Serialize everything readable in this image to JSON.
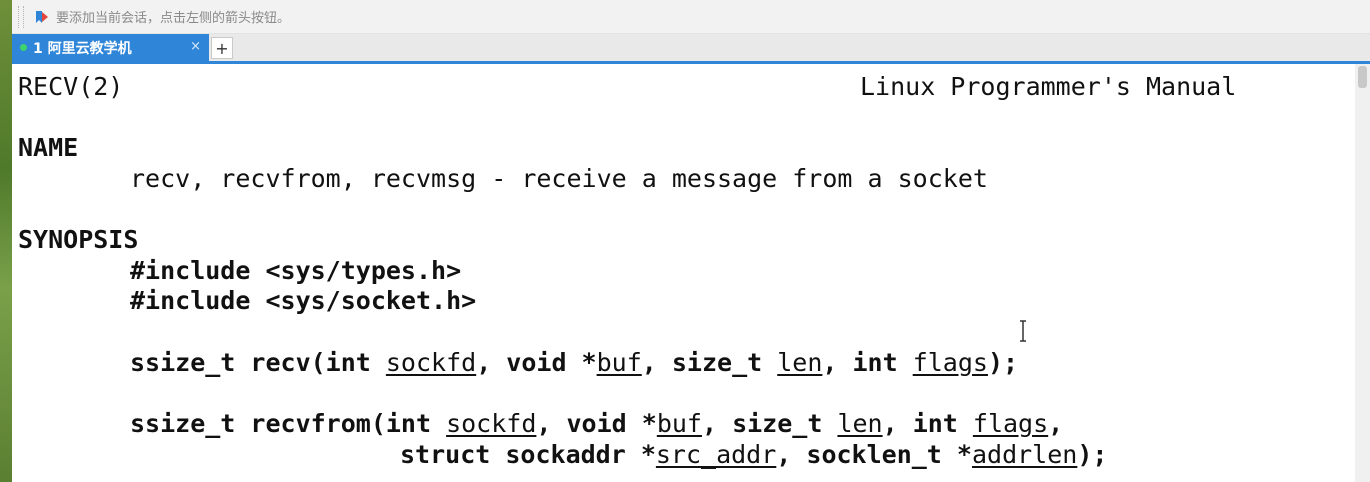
{
  "hint_bar": {
    "icon": "bookmark-arrow-icon",
    "text": "要添加当前会话，点击左侧的箭头按钮。"
  },
  "tabs": [
    {
      "label": "1 阿里云教学机",
      "active": true,
      "status_color": "#3fd36b",
      "close_glyph": "×"
    }
  ],
  "add_tab_label": "+",
  "man_page": {
    "header_left": "RECV(2)",
    "header_right": "Linux Programmer's Manual",
    "name_heading": "NAME",
    "name_desc": "recv, recvfrom, recvmsg - receive a message from a socket",
    "synopsis_heading": "SYNOPSIS",
    "include_1": "#include <sys/types.h>",
    "include_2": "#include <sys/socket.h>",
    "recv": {
      "ret": "ssize_t recv(int ",
      "sockfd": "sockfd",
      "s1": ", void *",
      "buf": "buf",
      "s2": ", size_t ",
      "len": "len",
      "s3": ", int ",
      "flags": "flags",
      "end": ");"
    },
    "recvfrom": {
      "ret": "ssize_t recvfrom(int ",
      "sockfd": "sockfd",
      "s1": ", void *",
      "buf": "buf",
      "s2": ", size_t ",
      "len": "len",
      "s3": ", int ",
      "flags": "flags",
      "end": ","
    },
    "recvfrom_cont": {
      "s1": "struct sockaddr *",
      "src_addr": "src_addr",
      "s2": ", socklen_t *",
      "addrlen": "addrlen",
      "end": ");"
    }
  },
  "colors": {
    "accent": "#2f86d8",
    "terminal_bg": "#ffffff",
    "terminal_fg": "#111111"
  }
}
